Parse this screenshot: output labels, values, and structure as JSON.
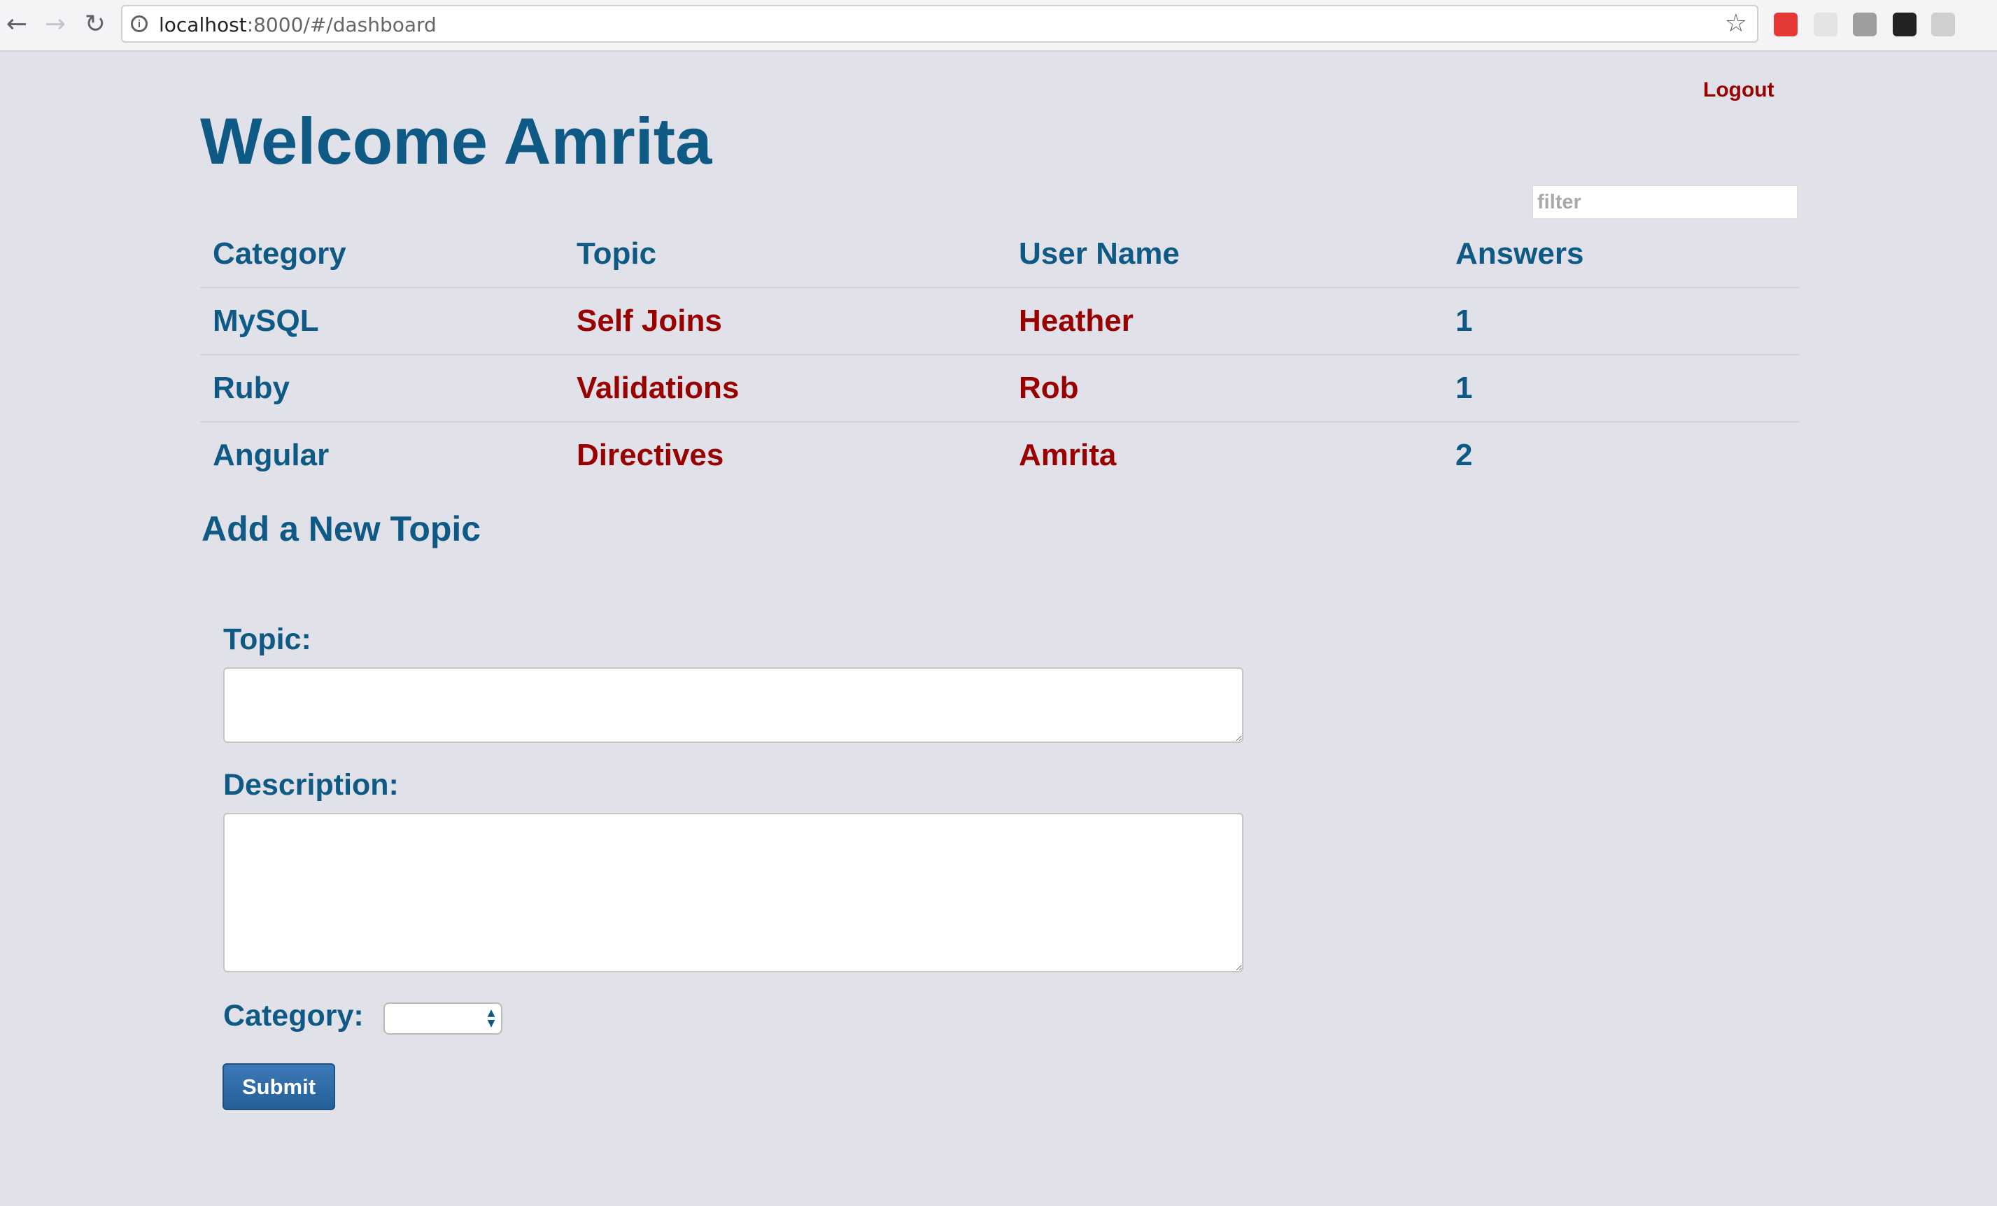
{
  "browser": {
    "url_host": "localhost",
    "url_rest": ":8000/#/dashboard",
    "icons": [
      "back-icon",
      "forward-icon",
      "reload-icon",
      "info-icon",
      "star-icon"
    ]
  },
  "header": {
    "logout_label": "Logout",
    "welcome": "Welcome Amrita"
  },
  "filter": {
    "placeholder": "filter",
    "value": ""
  },
  "table": {
    "headers": [
      "Category",
      "Topic",
      "User Name",
      "Answers"
    ],
    "rows": [
      {
        "category": "MySQL",
        "topic": "Self Joins",
        "user": "Heather",
        "answers": "1"
      },
      {
        "category": "Ruby",
        "topic": "Validations",
        "user": "Rob",
        "answers": "1"
      },
      {
        "category": "Angular",
        "topic": "Directives",
        "user": "Amrita",
        "answers": "2"
      }
    ]
  },
  "form": {
    "title": "Add a New Topic",
    "topic_label": "Topic:",
    "topic_value": "",
    "description_label": "Description:",
    "description_value": "",
    "category_label": "Category:",
    "category_selected": "",
    "submit_label": "Submit"
  },
  "colors": {
    "primary_blue": "#0f5a85",
    "link_red": "#990000",
    "background": "#e1e1e9"
  }
}
